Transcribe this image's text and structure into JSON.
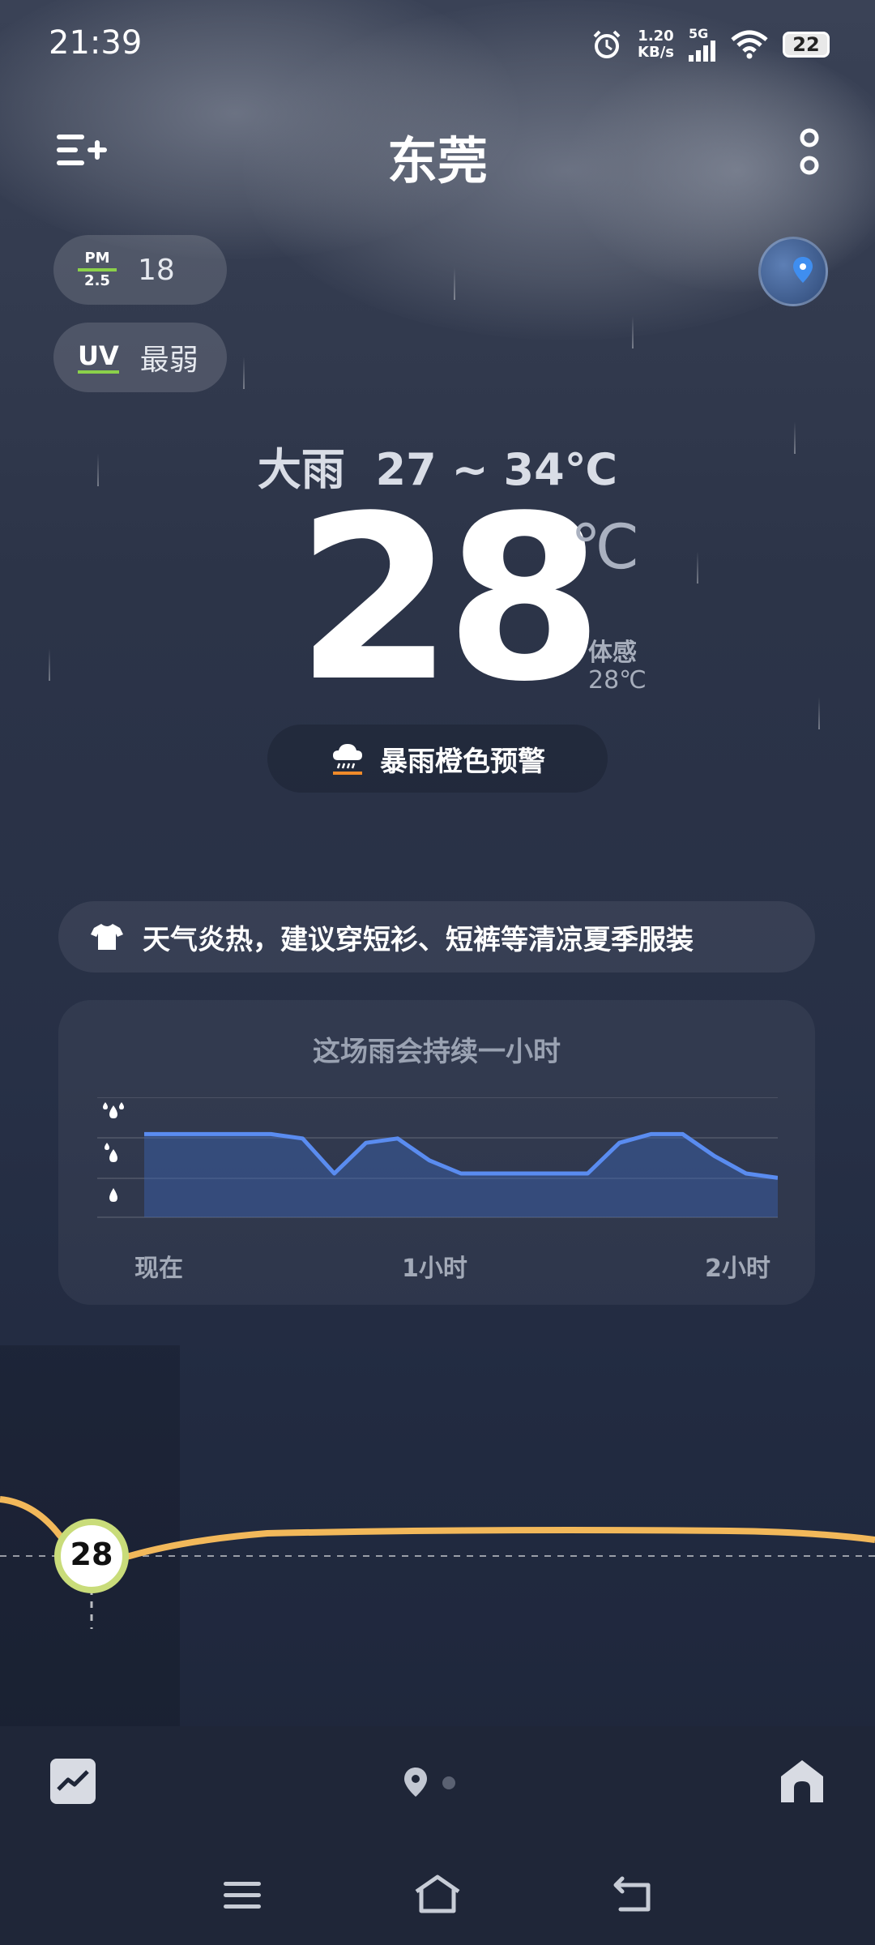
{
  "status_bar": {
    "time": "21:39",
    "speed_value": "1.20",
    "speed_unit": "KB/s",
    "network": "5G",
    "battery": "22"
  },
  "header": {
    "city": "东莞"
  },
  "air": {
    "pm_label_top": "PM",
    "pm_label_bottom": "2.5",
    "pm_value": "18",
    "uv_label": "UV",
    "uv_value": "最弱"
  },
  "weather": {
    "condition": "大雨  27 ~ 34℃",
    "temperature": "28",
    "unit": "℃",
    "feels_label": "体感",
    "feels_value": "28℃",
    "alert": "暴雨橙色预警"
  },
  "tip": {
    "text": "天气炎热，建议穿短衫、短裤等清凉夏季服装"
  },
  "rain_card": {
    "title": "这场雨会持续一小时",
    "x_labels": [
      "现在",
      "1小时",
      "2小时"
    ]
  },
  "chart_data": {
    "type": "area",
    "title": "这场雨会持续一小时",
    "x": [
      "现在",
      "",
      "",
      "",
      "",
      "",
      "",
      "",
      "",
      "",
      "1小时",
      "",
      "",
      "",
      "",
      "",
      "",
      "",
      "",
      "",
      "2小时"
    ],
    "values": [
      2.9,
      2.9,
      2.9,
      2.9,
      2.9,
      2.8,
      2.0,
      2.7,
      2.8,
      2.3,
      2.0,
      2.0,
      2.0,
      2.0,
      2.0,
      2.7,
      2.9,
      2.9,
      2.4,
      2.0,
      1.9
    ],
    "y_levels": [
      "light",
      "moderate",
      "heavy"
    ],
    "ylim": [
      1,
      3
    ],
    "grid": true,
    "colors": {
      "line": "#5a8cf0",
      "fill": "#2f4f88"
    }
  },
  "hourly": {
    "current_temp": "28"
  },
  "colors": {
    "accent_green": "#8bd14a",
    "temp_curve": "#f2b85a"
  }
}
